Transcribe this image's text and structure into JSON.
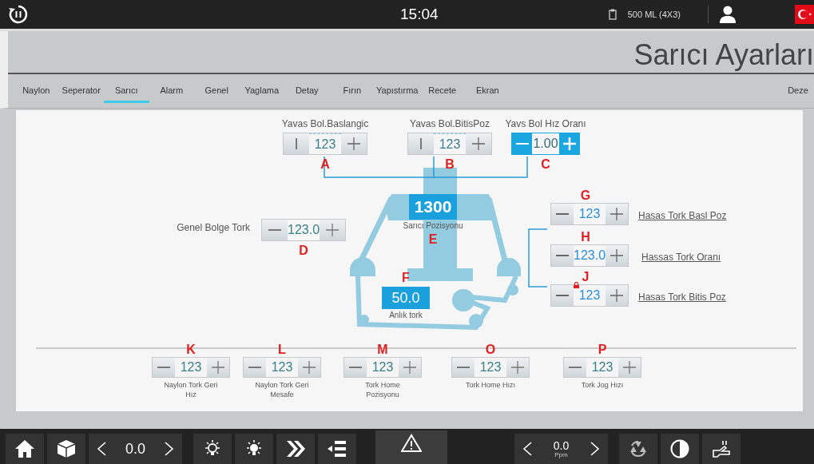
{
  "top_bar": {
    "time": "15:04",
    "recipe": "500 ML  (4X3)"
  },
  "page_title": "Sarıcı Ayarları",
  "tabs": [
    {
      "label": "Naylon",
      "selected": false
    },
    {
      "label": "Seperator",
      "selected": false
    },
    {
      "label": "Sarıcı",
      "selected": true
    },
    {
      "label": "Alarm",
      "selected": false
    },
    {
      "label": "Genel",
      "selected": false
    },
    {
      "label": "Yaglama",
      "selected": false
    },
    {
      "label": "Detay",
      "selected": false
    },
    {
      "label": "Fırın",
      "selected": false
    },
    {
      "label": "Yapıstırma",
      "selected": false
    },
    {
      "label": "Recete",
      "selected": false
    },
    {
      "label": "Ekran",
      "selected": false
    },
    {
      "label": "Deze",
      "selected": false
    }
  ],
  "top_controls": [
    {
      "label": "Yavas Bol.Baslangic",
      "value": "123",
      "marker": "A",
      "kind": "bar",
      "locked": false
    },
    {
      "label": "Yavas Bol.BitisPoz",
      "value": "123",
      "marker": "B",
      "kind": "bar",
      "locked": false
    },
    {
      "label": "Yavs Bol Hız Oranı",
      "value": "1.00",
      "marker": "C",
      "kind": "accent",
      "locked": false
    }
  ],
  "left_control": {
    "label": "Genel Bolge Tork",
    "value": "123.0",
    "marker": "D",
    "kind": "standard",
    "locked": false
  },
  "position": {
    "value": "1300",
    "label": "Sarıcı Pozisyonu",
    "marker": "E"
  },
  "torque": {
    "value": "50.0",
    "label": "Anlık tork",
    "marker": "F"
  },
  "right_controls": [
    {
      "label": "Hasas Tork Basl Poz",
      "value": "123",
      "marker": "G",
      "kind": "bright",
      "locked": false
    },
    {
      "label": "Hassas Tork Oranı",
      "value": "123.0",
      "marker": "H",
      "kind": "bright",
      "locked": false
    },
    {
      "label": "Hasas Tork Bitis Poz",
      "value": "123",
      "marker": "J",
      "kind": "bright",
      "locked": true
    }
  ],
  "bottom_controls": [
    {
      "label": "Naylon Tork Geri Hız",
      "value": "123",
      "marker": "K",
      "kind": "standard",
      "locked": false
    },
    {
      "label": "Naylon Tork Geri Mesafe",
      "value": "123",
      "marker": "L",
      "kind": "standard",
      "locked": false
    },
    {
      "label": "Tork Home Pozisyonu",
      "value": "123",
      "marker": "M",
      "kind": "standard",
      "locked": false
    },
    {
      "label": "Tork Home Hızı",
      "value": "123",
      "marker": "O",
      "kind": "standard",
      "locked": false
    },
    {
      "label": "Tork Jog Hızı",
      "value": "123",
      "marker": "P",
      "kind": "standard",
      "locked": false
    }
  ],
  "bottom_bar": {
    "speed": "0.0",
    "rate": "0.0",
    "rate_unit": "Ppm"
  }
}
